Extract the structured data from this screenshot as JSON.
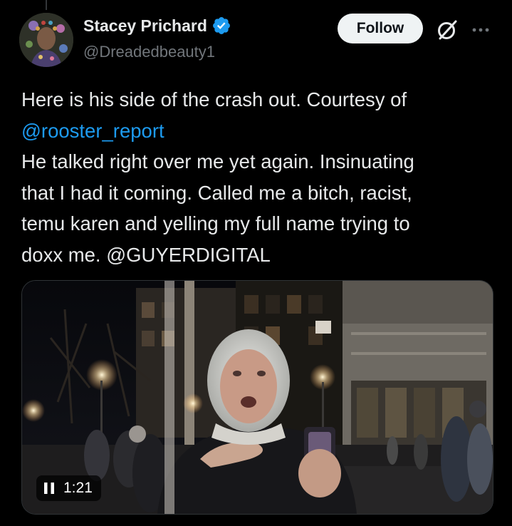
{
  "tweet": {
    "author": {
      "display_name": "Stacey Prichard",
      "handle": "@Dreadedbeauty1",
      "verified": true,
      "avatar_icon": "profile-avatar"
    },
    "follow_label": "Follow",
    "icons": {
      "grok": "grok-icon",
      "more": "more-options-icon",
      "verified": "verified-badge-icon"
    },
    "text_lines": [
      "Here is his side of the crash out. Courtesy of",
      "@rooster_report",
      "He talked right over me yet again. Insinuating",
      "that I had it coming. Called me a bitch, racist,",
      "temu karen and yelling my full name trying to",
      "doxx me. "
    ],
    "mentions": {
      "first": "@rooster_report",
      "second": "@GUYERDIGITAL"
    },
    "media": {
      "type": "video",
      "duration": "1:21",
      "state_icon": "pause-icon"
    },
    "colors": {
      "background": "#000000",
      "text": "#e7e9ea",
      "secondary": "#71767b",
      "link": "#1d9bf0",
      "verified": "#1d9bf0",
      "follow_bg": "#eff3f4"
    }
  }
}
